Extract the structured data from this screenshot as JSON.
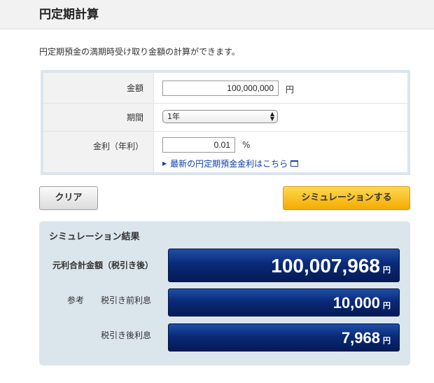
{
  "header": {
    "title": "円定期計算"
  },
  "intro": "円定期預金の満期時受け取り金額の計算ができます。",
  "form": {
    "amount": {
      "label": "金額",
      "value": "100,000,000",
      "unit": "円"
    },
    "period": {
      "label": "期間",
      "selected": "1年"
    },
    "rate": {
      "label": "金利（年利）",
      "value": "0.01",
      "unit": "%",
      "link_text": "最新の円定期預金金利はこちら"
    }
  },
  "buttons": {
    "clear": "クリア",
    "simulate": "シミュレーションする"
  },
  "result": {
    "title": "シミュレーション結果",
    "total": {
      "label": "元利合計金額（税引き後）",
      "value": "100,007,968",
      "unit": "円"
    },
    "reference": "参考",
    "pretax": {
      "label": "税引き前利息",
      "value": "10,000",
      "unit": "円"
    },
    "aftertax": {
      "label": "税引き後利息",
      "value": "7,968",
      "unit": "円"
    }
  },
  "colors": {
    "accent_blue": "#0a2a78",
    "button_yellow": "#f3ac00",
    "panel_bg": "#dbe5ec",
    "link_blue": "#0b3fa8"
  },
  "icons": {
    "link_arrow": "play-arrow-icon",
    "external": "external-window-icon",
    "select": "select-arrows-icon"
  }
}
